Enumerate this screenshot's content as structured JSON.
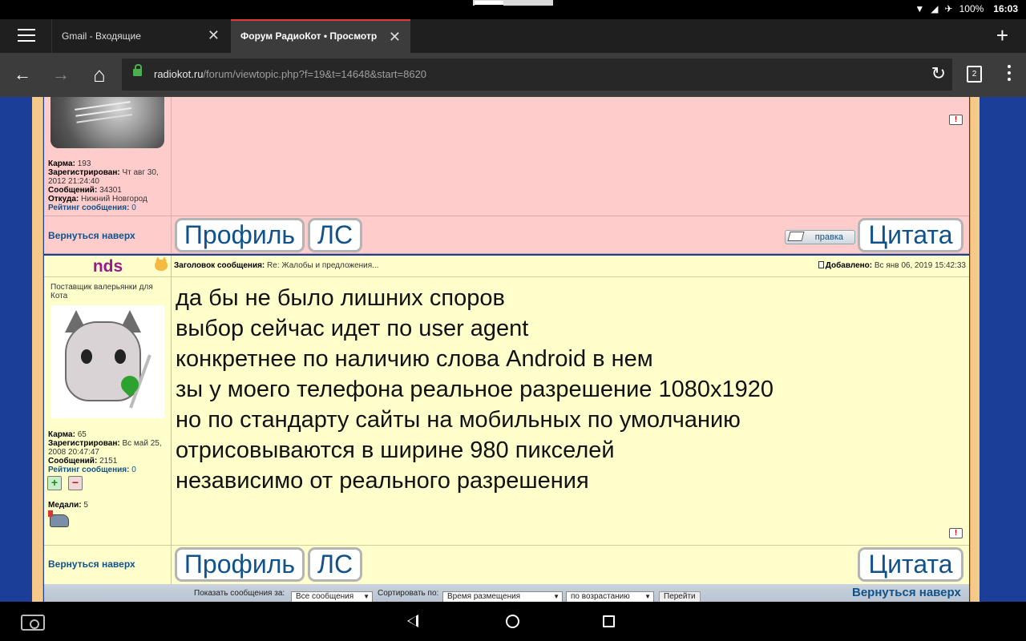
{
  "status_bar": {
    "battery": "100%",
    "time": "16:03"
  },
  "tabs": [
    {
      "title": "Gmail - Входящие",
      "close": "✕"
    },
    {
      "title": "Форум РадиоКот • Просмотр т",
      "close": "✕"
    }
  ],
  "new_tab_label": "+",
  "toolbar": {
    "back": "←",
    "forward": "→",
    "home": "⌂",
    "url_host": "radiokot.ru",
    "url_path": "/forum/viewtopic.php?f=19&t=14648&start=8620",
    "reload": "↻",
    "tab_count": "2"
  },
  "post1": {
    "karma_label": "Карма:",
    "karma": "193",
    "registered_label": "Зарегистрирован:",
    "registered": "Чт авг 30, 2012 21:24:40",
    "messages_label": "Сообщений:",
    "messages": "34301",
    "from_label": "Откуда:",
    "from": "Нижний Новгород",
    "rating_label": "Рейтинг сообщения:",
    "rating": "0",
    "back_to_top": "Вернуться наверх",
    "profile": "Профиль",
    "pm": "ЛС",
    "edit": "правка",
    "quote": "Цитата",
    "report": "!"
  },
  "post2": {
    "author": "nds",
    "subject_label": "Заголовок сообщения:",
    "subject": "Re: Жалобы и предложения...",
    "posted_label": "Добавлено:",
    "posted": "Вс янв 06, 2019 15:42:33",
    "rank": "Поставщик валерьянки для Кота",
    "karma_label": "Карма:",
    "karma": "65",
    "registered_label": "Зарегистрирован:",
    "registered": "Вс май 25, 2008 20:47:47",
    "messages_label": "Сообщений:",
    "messages": "2151",
    "rating_label": "Рейтинг сообщения:",
    "rating": "0",
    "vote_plus": "+",
    "vote_minus": "−",
    "medals_label": "Медали:",
    "medals": "5",
    "message_lines": [
      "да бы не было лишних споров",
      "выбор сейчас идет по user agent",
      "конкретнее по наличию слова Android в нем",
      "зы у моего телефона реальное разрешение 1080x1920",
      "но по стандарту сайты на мобильных по умолчанию",
      "отрисовываются в ширине 980 пикселей",
      "независимо от реального разрешения"
    ],
    "back_to_top": "Вернуться наверх",
    "profile": "Профиль",
    "pm": "ЛС",
    "quote": "Цитата",
    "report": "!"
  },
  "pagebar": {
    "show_label": "Показать сообщения за:",
    "show_value": "Все сообщения",
    "sort_label": "Сортировать по:",
    "sort_value": "Время размещения",
    "order_value": "по возрастанию",
    "go": "Перейти",
    "back_to_top": "Вернуться наверх"
  }
}
